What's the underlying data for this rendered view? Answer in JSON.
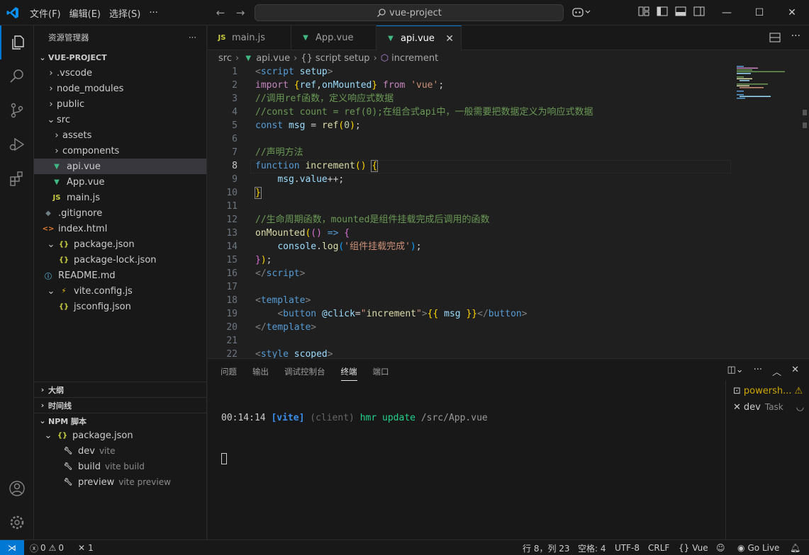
{
  "window": {
    "search_text": "vue-project"
  },
  "menu": [
    "文件(F)",
    "编辑(E)",
    "选择(S)",
    "···"
  ],
  "explorer": {
    "title": "资源管理器",
    "more": "···",
    "root": "VUE-PROJECT",
    "items": [
      ".vscode",
      "node_modules",
      "public",
      "src",
      "assets",
      "components",
      "api.vue",
      "App.vue",
      "main.js",
      ".gitignore",
      "index.html",
      "package.json",
      "package-lock.json",
      "README.md",
      "vite.config.js",
      "jsconfig.json"
    ]
  },
  "sections": {
    "outline": "大纲",
    "timeline": "时间线",
    "npm": "NPM 脚本"
  },
  "npm": {
    "package": "package.json",
    "scripts": [
      {
        "name": "dev",
        "cmd": "vite"
      },
      {
        "name": "build",
        "cmd": "vite build"
      },
      {
        "name": "preview",
        "cmd": "vite preview"
      }
    ]
  },
  "tabs": [
    "main.js",
    "App.vue",
    "api.vue"
  ],
  "breadcrumb": [
    "src",
    "api.vue",
    "script setup",
    "increment"
  ],
  "editor": {
    "line_numbers": [
      "1",
      "2",
      "3",
      "4",
      "5",
      "6",
      "7",
      "8",
      "9",
      "10",
      "11",
      "12",
      "13",
      "14",
      "15",
      "16",
      "17",
      "18",
      "19",
      "20",
      "21",
      "22"
    ],
    "current_line": 8
  },
  "panel": {
    "tabs": [
      "问题",
      "输出",
      "调试控制台",
      "终端",
      "端口"
    ],
    "active_tab": "终端",
    "terminal": {
      "time": "00:14:14",
      "tag": "[vite]",
      "client": "(client)",
      "msg": "hmr update",
      "path": "/src/App.vue"
    },
    "terminals": [
      {
        "name": "powersh...",
        "sub": ""
      },
      {
        "name": "dev",
        "sub": "Task"
      }
    ]
  },
  "status": {
    "errors": "0",
    "warnings": "0",
    "ports": "1",
    "position": "行 8，列 23",
    "spaces": "空格: 4",
    "encoding": "UTF-8",
    "eol": "CRLF",
    "language": "Vue",
    "golive": "Go Live"
  },
  "colors": {
    "accent": "#0078d4",
    "vue": "#42b883",
    "js": "#cbcb41",
    "json": "#cbcb41",
    "html": "#e37933",
    "info": "#519aba",
    "warning": "#cca700"
  }
}
